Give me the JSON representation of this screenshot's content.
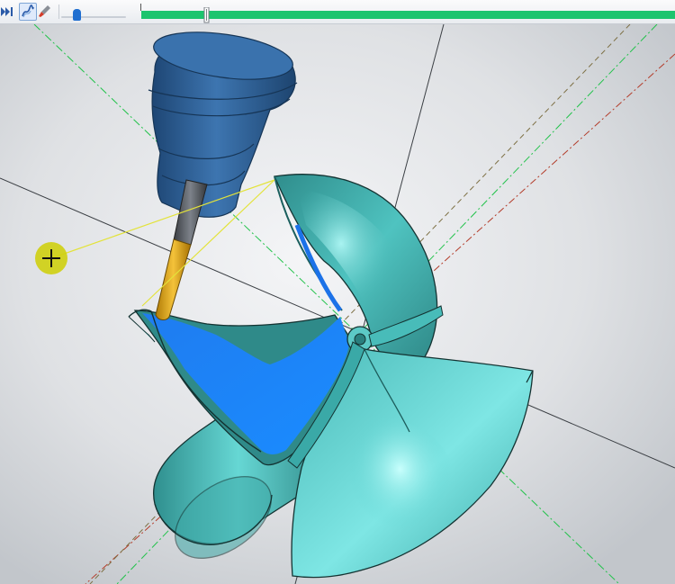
{
  "toolbar": {
    "buttons": [
      {
        "icon": "play-to-end-icon"
      },
      {
        "icon": "toolpath-display-icon",
        "active": true
      },
      {
        "icon": "tool-display-icon"
      }
    ],
    "speed_level": 0.22,
    "simulation_progress": 1.0,
    "marker_position": 0.12,
    "progress_color": "#1cc46e",
    "accent_color": "#1f6ed0"
  },
  "viewport": {
    "model": "propeller",
    "model_color": "#45b5b2",
    "machined_region_color": "#1f86f5",
    "holder_color": "#2b5d93",
    "tool_color": "#e6a514",
    "cursor": {
      "icon": "crosshair-cursor-icon",
      "highlight_color": "#cfcf10"
    }
  }
}
